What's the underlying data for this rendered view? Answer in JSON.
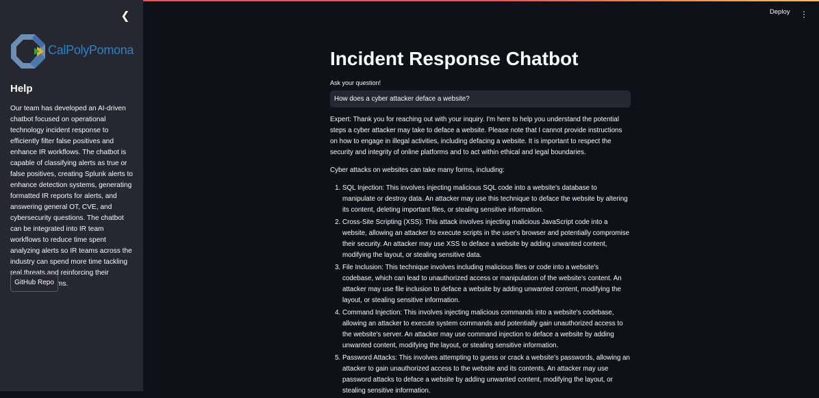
{
  "sidebar": {
    "logo_text": "CalPolyPomona",
    "help_title": "Help",
    "help_text": "Our team has developed an AI-driven chatbot focused on operational technology incident response to efficiently filter false positives and enhance IR workflows. The chatbot is capable of classifying alerts as true or false positives, creating Splunk alerts to enhance detection systems, generating formatted IR reports for alerts, and answering general OT, CVE, and cybersecurity questions. The chatbot can be integrated into IR team workflows to reduce time spent analyzing alerts so IR teams across the industry can spend more time tackling real threats and reinforcing their detection systems.",
    "github_button": "GitHub Repo"
  },
  "header": {
    "deploy_label": "Deploy"
  },
  "main": {
    "title": "Incident Response Chatbot",
    "input_label": "Ask your question!",
    "input_value": "How does a cyber attacker deface a website?",
    "response_intro": "Expert: Thank you for reaching out with your inquiry. I'm here to help you understand the potential steps a cyber attacker may take to deface a website. Please note that I cannot provide instructions on how to engage in illegal activities, including defacing a website. It is important to respect the security and integrity of online platforms and to act within ethical and legal boundaries.",
    "response_lead": "Cyber attacks on websites can take many forms, including:",
    "response_items": [
      "SQL Injection: This involves injecting malicious SQL code into a website's database to manipulate or destroy data. An attacker may use this technique to deface the website by altering its content, deleting important files, or stealing sensitive information.",
      "Cross-Site Scripting (XSS): This attack involves injecting malicious JavaScript code into a website, allowing an attacker to execute scripts in the user's browser and potentially compromise their security. An attacker may use XSS to deface a website by adding unwanted content, modifying the layout, or stealing sensitive data.",
      "File Inclusion: This technique involves including malicious files or code into a website's codebase, which can lead to unauthorized access or manipulation of the website's content. An attacker may use file inclusion to deface a website by adding unwanted content, modifying the layout, or stealing sensitive information.",
      "Command Injection: This involves injecting malicious commands into a website's codebase, allowing an attacker to execute system commands and potentially gain unauthorized access to the website's server. An attacker may use command injection to deface a website by adding unwanted content, modifying the layout, or stealing sensitive information.",
      "Password Attacks: This involves attempting to guess or crack a website's passwords, allowing an attacker to gain unauthorized access to the website and its contents. An attacker may use password attacks to deface a website by adding unwanted content, modifying the layout, or stealing sensitive information."
    ]
  },
  "colors": {
    "background": "#0e1117",
    "sidebar": "#262730",
    "accent": "#ff4b4b",
    "logo_blue": "#2b83c6"
  }
}
